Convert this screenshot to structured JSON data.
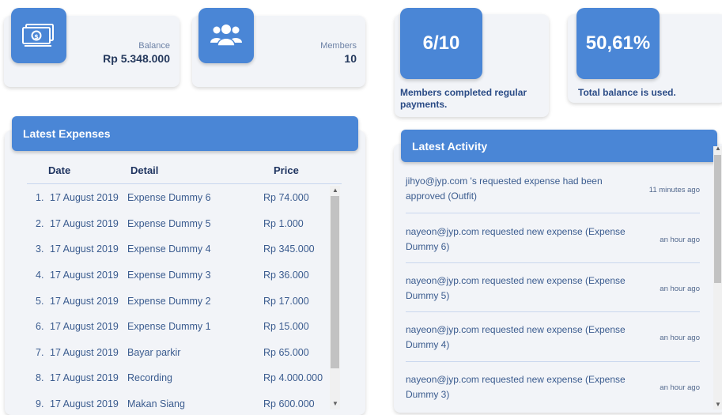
{
  "stats": {
    "balance": {
      "icon": "money-icon",
      "label": "Balance",
      "value": "Rp 5.348.000"
    },
    "members": {
      "icon": "users-icon",
      "label": "Members",
      "value": "10"
    },
    "payments": {
      "value": "6/10",
      "caption": "Members completed regular payments."
    },
    "usage": {
      "value": "50,61%",
      "caption": "Total balance is used."
    }
  },
  "expenses": {
    "title": "Latest Expenses",
    "columns": [
      "Date",
      "Detail",
      "Price"
    ],
    "rows": [
      {
        "no": "1.",
        "date": "17 August 2019",
        "detail": "Expense Dummy 6",
        "price": "Rp 74.000"
      },
      {
        "no": "2.",
        "date": "17 August 2019",
        "detail": "Expense Dummy 5",
        "price": "Rp 1.000"
      },
      {
        "no": "3.",
        "date": "17 August 2019",
        "detail": "Expense Dummy 4",
        "price": "Rp 345.000"
      },
      {
        "no": "4.",
        "date": "17 August 2019",
        "detail": "Expense Dummy 3",
        "price": "Rp 36.000"
      },
      {
        "no": "5.",
        "date": "17 August 2019",
        "detail": "Expense Dummy 2",
        "price": "Rp 17.000"
      },
      {
        "no": "6.",
        "date": "17 August 2019",
        "detail": "Expense Dummy 1",
        "price": "Rp 15.000"
      },
      {
        "no": "7.",
        "date": "17 August 2019",
        "detail": "Bayar parkir",
        "price": "Rp 65.000"
      },
      {
        "no": "8.",
        "date": "17 August 2019",
        "detail": "Recording",
        "price": "Rp 4.000.000"
      },
      {
        "no": "9.",
        "date": "17 August 2019",
        "detail": "Makan Siang",
        "price": "Rp 600.000"
      }
    ]
  },
  "activity": {
    "title": "Latest Activity",
    "items": [
      {
        "text": "jihyo@jyp.com 's requested expense had been approved (Outfit)",
        "time": "11 minutes ago"
      },
      {
        "text": "nayeon@jyp.com requested new expense (Expense Dummy 6)",
        "time": "an hour ago"
      },
      {
        "text": "nayeon@jyp.com requested new expense (Expense Dummy 5)",
        "time": "an hour ago"
      },
      {
        "text": "nayeon@jyp.com requested new expense (Expense Dummy 4)",
        "time": "an hour ago"
      },
      {
        "text": "nayeon@jyp.com requested new expense (Expense Dummy 3)",
        "time": "an hour ago"
      }
    ]
  },
  "colors": {
    "accent": "#4a86d6",
    "card": "#f2f4f8"
  }
}
